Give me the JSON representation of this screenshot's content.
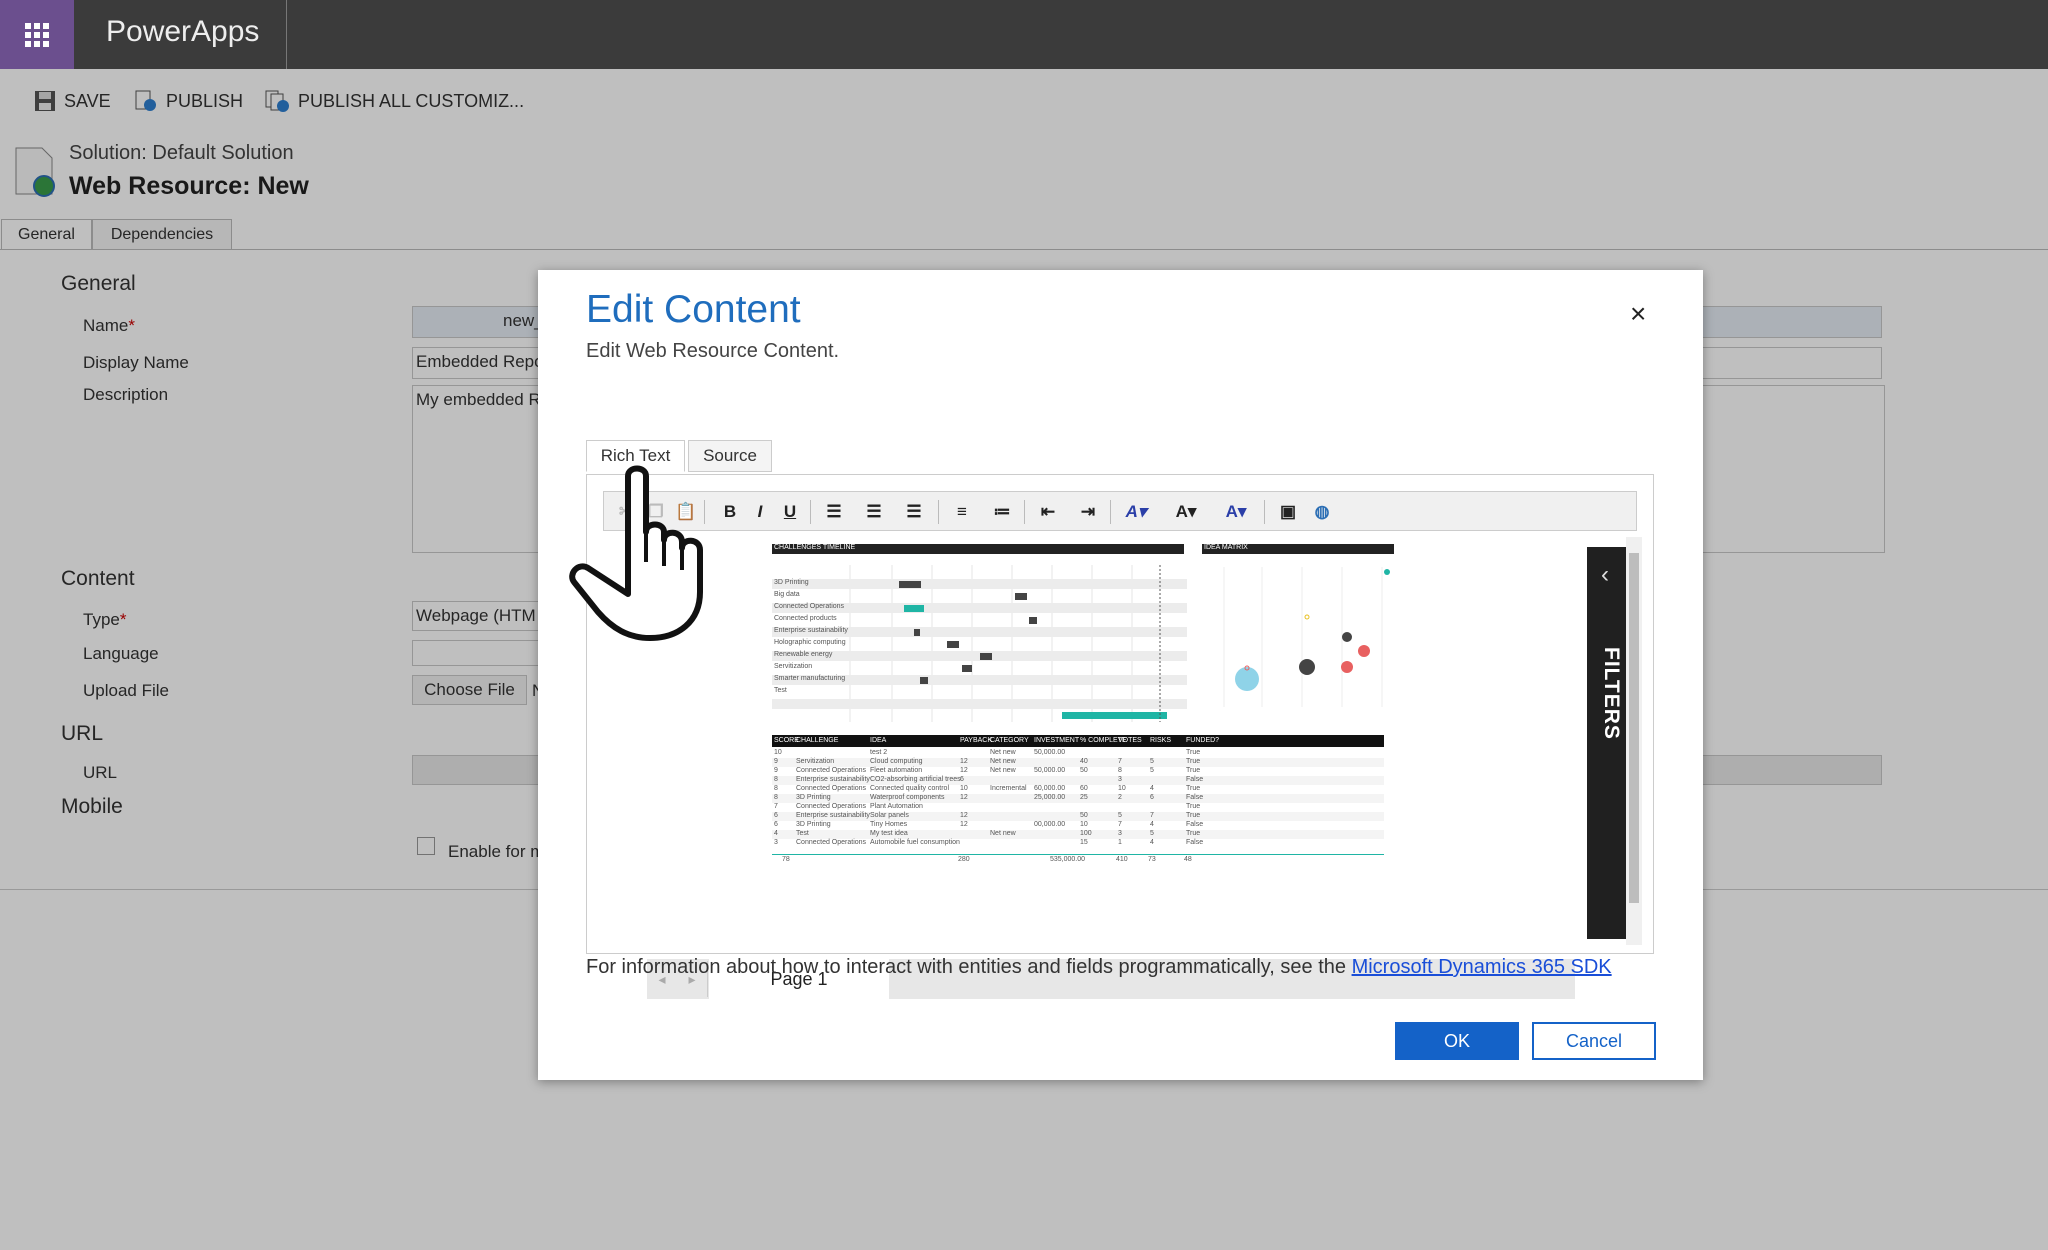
{
  "app": {
    "title": "PowerApps"
  },
  "commands": {
    "save": "SAVE",
    "publish": "PUBLISH",
    "publish_all": "PUBLISH ALL CUSTOMIZ..."
  },
  "header": {
    "solution": "Solution: Default Solution",
    "title": "Web Resource: New"
  },
  "tabs": [
    "General",
    "Dependencies"
  ],
  "form": {
    "general_section": "General",
    "name_label": "Name",
    "name_value": "new_",
    "display_name_label": "Display Name",
    "display_name_value": "Embedded Repo",
    "description_label": "Description",
    "description_value": "My embedded R",
    "content_section": "Content",
    "type_label": "Type",
    "type_value": "Webpage (HTM",
    "language_label": "Language",
    "upload_label": "Upload File",
    "choose_file": "Choose File",
    "choose_file_suffix": "N",
    "url_section": "URL",
    "url_label": "URL",
    "mobile_section": "Mobile",
    "enable_label": "Enable for m",
    "required_mark": "*"
  },
  "dialog": {
    "title": "Edit Content",
    "subtitle": "Edit Web Resource Content.",
    "close": "×",
    "tabs": [
      "Rich Text",
      "Source"
    ],
    "toolbar": {
      "bold": "B",
      "italic": "I",
      "underline": "U"
    },
    "info_text": "For information about how to interact with entities and fields programmatically, see the ",
    "info_link": "Microsoft Dynamics 365 SDK",
    "ok": "OK",
    "cancel": "Cancel"
  },
  "report": {
    "timeline_title": "CHALLENGES TIMELINE",
    "matrix_title": "IDEA MATRIX",
    "filters": "FILTERS",
    "page": "Page 1",
    "timeline_rows": [
      "3D Printing",
      "Big data",
      "Connected Operations",
      "Connected products",
      "Enterprise sustainability",
      "Holographic computing",
      "Renewable energy",
      "Servitization",
      "Smarter manufacturing",
      "Test"
    ],
    "table_headers": [
      "SCORE",
      "CHALLENGE",
      "IDEA",
      "PAYBACK",
      "CATEGORY",
      "INVESTMENT",
      "% COMPLETE",
      "VOTES",
      "RISKS",
      "FUNDED?"
    ],
    "table_rows": [
      [
        "10",
        "",
        "test 2",
        "",
        "Net new",
        "50,000.00",
        "",
        "",
        "",
        "True"
      ],
      [
        "9",
        "Servitization",
        "Cloud computing",
        "12",
        "Net new",
        "",
        "40",
        "7",
        "5",
        "True"
      ],
      [
        "9",
        "Connected Operations",
        "Fleet automation",
        "12",
        "Net new",
        "50,000.00",
        "50",
        "8",
        "5",
        "True"
      ],
      [
        "8",
        "Enterprise sustainability",
        "CO2-absorbing artificial trees",
        "6",
        "",
        "",
        "",
        "3",
        "",
        "False"
      ],
      [
        "8",
        "Connected Operations",
        "Connected quality control",
        "10",
        "Incremental",
        "60,000.00",
        "60",
        "10",
        "4",
        "True"
      ],
      [
        "8",
        "3D Printing",
        "Waterproof components",
        "12",
        "",
        "25,000.00",
        "25",
        "2",
        "6",
        "False"
      ],
      [
        "7",
        "Connected Operations",
        "Plant Automation",
        "",
        "",
        "",
        "",
        "",
        "",
        "True"
      ],
      [
        "6",
        "Enterprise sustainability",
        "Solar panels",
        "12",
        "",
        "",
        "50",
        "5",
        "7",
        "True"
      ],
      [
        "6",
        "3D Printing",
        "Tiny Homes",
        "12",
        "",
        "00,000.00",
        "10",
        "7",
        "4",
        "False"
      ],
      [
        "4",
        "Test",
        "My test idea",
        "",
        "Net new",
        "",
        "100",
        "3",
        "5",
        "True"
      ],
      [
        "3",
        "Connected Operations",
        "Automobile fuel consumption",
        "",
        "",
        "",
        "15",
        "1",
        "4",
        "False"
      ]
    ],
    "totals": [
      "78",
      "280",
      "535,000.00",
      "410",
      "73",
      "48"
    ]
  }
}
